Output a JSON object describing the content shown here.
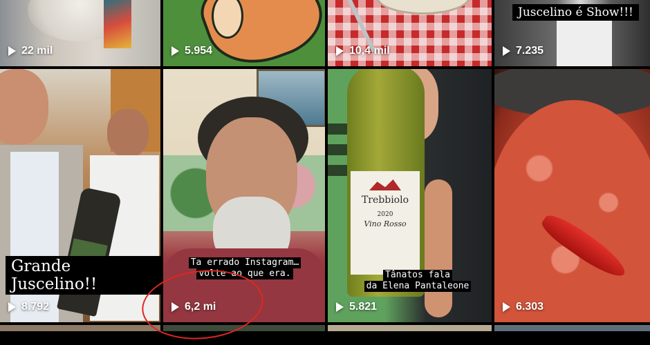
{
  "grid": {
    "row1": [
      {
        "views": "22 mil"
      },
      {
        "views": "5.954"
      },
      {
        "views": "10,4 mil"
      },
      {
        "views": "7.235",
        "caption": "Juscelino é Show!!!"
      }
    ],
    "row2": [
      {
        "views": "8.792",
        "caption": "Grande Juscelino!!"
      },
      {
        "views": "6,2 mi",
        "caption_line1": "Ta errado Instagram…",
        "caption_line2": "volte ao que era."
      },
      {
        "views": "5.821",
        "caption_line1": "Tânatos fala",
        "caption_line2": "da Elena Pantaleone"
      },
      {
        "views": "6.303"
      }
    ]
  },
  "bottle": {
    "brand": "Trebbiolo",
    "year": "2020",
    "type": "Vino Rosso"
  },
  "colors": {
    "annotation": "#e0271f",
    "gap": "#000000"
  }
}
